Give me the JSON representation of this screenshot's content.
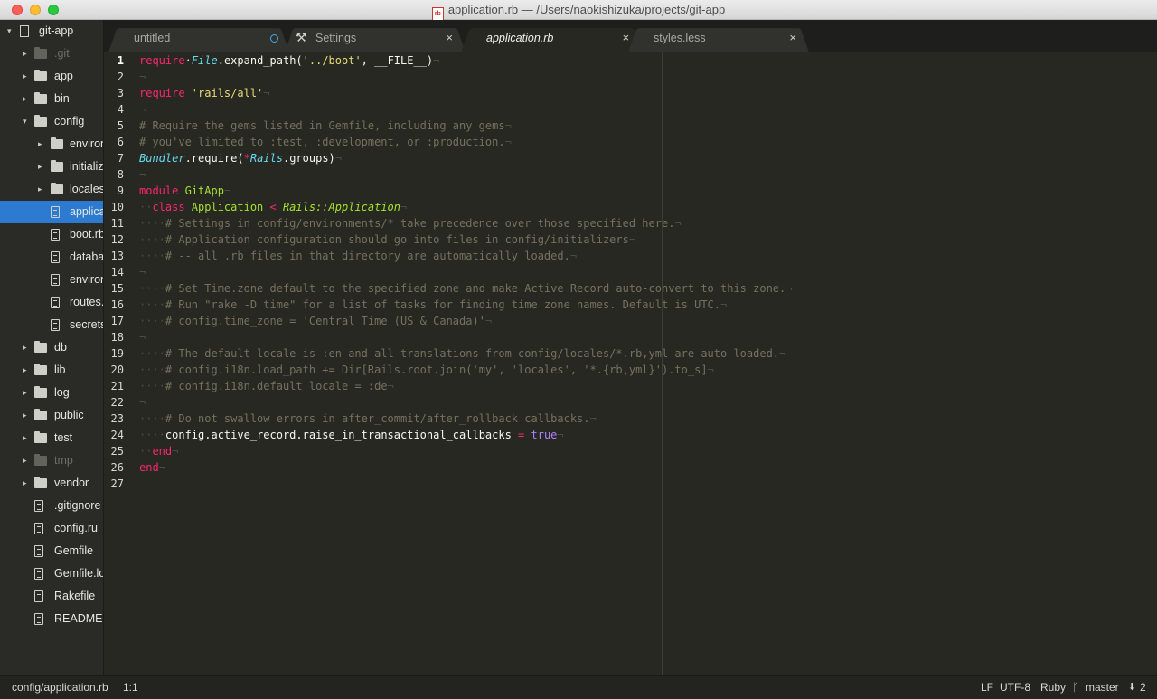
{
  "window": {
    "title": "application.rb — /Users/naokishizuka/projects/git-app",
    "file_badge": "rb"
  },
  "sidebar": {
    "items": [
      {
        "label": "git-app",
        "kind": "repo",
        "depth": 0,
        "arrow": "▾"
      },
      {
        "label": ".git",
        "kind": "folder",
        "depth": 1,
        "arrow": "▸",
        "dim": true
      },
      {
        "label": "app",
        "kind": "folder",
        "depth": 1,
        "arrow": "▸"
      },
      {
        "label": "bin",
        "kind": "folder",
        "depth": 1,
        "arrow": "▸"
      },
      {
        "label": "config",
        "kind": "folder",
        "depth": 1,
        "arrow": "▾"
      },
      {
        "label": "environments",
        "kind": "folder",
        "depth": 2,
        "arrow": "▸"
      },
      {
        "label": "initializers",
        "kind": "folder",
        "depth": 2,
        "arrow": "▸"
      },
      {
        "label": "locales",
        "kind": "folder",
        "depth": 2,
        "arrow": "▸"
      },
      {
        "label": "application.rb",
        "kind": "file",
        "depth": 2,
        "selected": true
      },
      {
        "label": "boot.rb",
        "kind": "file",
        "depth": 2
      },
      {
        "label": "database.yml",
        "kind": "file",
        "depth": 2
      },
      {
        "label": "environment.rb",
        "kind": "file",
        "depth": 2
      },
      {
        "label": "routes.rb",
        "kind": "file",
        "depth": 2
      },
      {
        "label": "secrets.yml",
        "kind": "file",
        "depth": 2
      },
      {
        "label": "db",
        "kind": "folder",
        "depth": 1,
        "arrow": "▸"
      },
      {
        "label": "lib",
        "kind": "folder",
        "depth": 1,
        "arrow": "▸"
      },
      {
        "label": "log",
        "kind": "folder",
        "depth": 1,
        "arrow": "▸"
      },
      {
        "label": "public",
        "kind": "folder",
        "depth": 1,
        "arrow": "▸"
      },
      {
        "label": "test",
        "kind": "folder",
        "depth": 1,
        "arrow": "▸"
      },
      {
        "label": "tmp",
        "kind": "folder",
        "depth": 1,
        "arrow": "▸",
        "dim": true
      },
      {
        "label": "vendor",
        "kind": "folder",
        "depth": 1,
        "arrow": "▸"
      },
      {
        "label": ".gitignore",
        "kind": "file",
        "depth": 1
      },
      {
        "label": "config.ru",
        "kind": "file",
        "depth": 1
      },
      {
        "label": "Gemfile",
        "kind": "file",
        "depth": 1
      },
      {
        "label": "Gemfile.lock",
        "kind": "file",
        "depth": 1
      },
      {
        "label": "Rakefile",
        "kind": "file",
        "depth": 1
      },
      {
        "label": "README.rdoc",
        "kind": "file",
        "depth": 1
      }
    ]
  },
  "tabs": [
    {
      "label": "untitled",
      "modified": true,
      "close": "",
      "icon": ""
    },
    {
      "label": "Settings",
      "close": "×",
      "icon": "⚒"
    },
    {
      "label": "application.rb",
      "close": "×",
      "active": true,
      "icon": ""
    },
    {
      "label": "styles.less",
      "close": "×",
      "icon": ""
    }
  ],
  "editor": {
    "current_line": 1,
    "lines": [
      [
        [
          "kw",
          "require"
        ],
        [
          "",
          "·"
        ],
        [
          "cls",
          "File"
        ],
        [
          "",
          ".expand_path("
        ],
        [
          "str",
          "'../boot'"
        ],
        [
          "",
          ", __FILE__)"
        ],
        [
          "inv",
          "¬"
        ]
      ],
      [
        [
          "inv",
          "¬"
        ]
      ],
      [
        [
          "kw",
          "require"
        ],
        [
          "",
          ""
        ],
        [
          "str",
          " 'rails/all'"
        ],
        [
          "inv",
          "¬"
        ]
      ],
      [
        [
          "inv",
          "¬"
        ]
      ],
      [
        [
          "cm",
          "# Require the gems listed in Gemfile, including any gems"
        ],
        [
          "inv",
          "¬"
        ]
      ],
      [
        [
          "cm",
          "# you've limited to :test, :development, or :production."
        ],
        [
          "inv",
          "¬"
        ]
      ],
      [
        [
          "cls",
          "Bundler"
        ],
        [
          "",
          ".require("
        ],
        [
          "op",
          "*"
        ],
        [
          "cls",
          "Rails"
        ],
        [
          "",
          ".groups)"
        ],
        [
          "inv",
          "¬"
        ]
      ],
      [
        [
          "inv",
          "¬"
        ]
      ],
      [
        [
          "kw",
          "module"
        ],
        [
          "",
          ""
        ],
        [
          "ent",
          " GitApp"
        ],
        [
          "inv",
          "¬"
        ]
      ],
      [
        [
          "inv",
          "··"
        ],
        [
          "kw",
          "class"
        ],
        [
          "ent",
          " Application "
        ],
        [
          "op",
          "<"
        ],
        [
          "inh",
          " Rails::Application"
        ],
        [
          "inv",
          "¬"
        ]
      ],
      [
        [
          "inv",
          "····"
        ],
        [
          "cm",
          "# Settings in config/environments/* take precedence over those specified here."
        ],
        [
          "inv",
          "¬"
        ]
      ],
      [
        [
          "inv",
          "····"
        ],
        [
          "cm",
          "# Application configuration should go into files in config/initializers"
        ],
        [
          "inv",
          "¬"
        ]
      ],
      [
        [
          "inv",
          "····"
        ],
        [
          "cm",
          "# -- all .rb files in that directory are automatically loaded."
        ],
        [
          "inv",
          "¬"
        ]
      ],
      [
        [
          "inv",
          "¬"
        ]
      ],
      [
        [
          "inv",
          "····"
        ],
        [
          "cm",
          "# Set Time.zone default to the specified zone and make Active Record auto-convert to this zone."
        ],
        [
          "inv",
          "¬"
        ]
      ],
      [
        [
          "inv",
          "····"
        ],
        [
          "cm",
          "# Run \"rake -D time\" for a list of tasks for finding time zone names. Default is UTC."
        ],
        [
          "inv",
          "¬"
        ]
      ],
      [
        [
          "inv",
          "····"
        ],
        [
          "cm",
          "# config.time_zone = 'Central Time (US & Canada)'"
        ],
        [
          "inv",
          "¬"
        ]
      ],
      [
        [
          "inv",
          "¬"
        ]
      ],
      [
        [
          "inv",
          "····"
        ],
        [
          "cm",
          "# The default locale is :en and all translations from config/locales/*.rb,yml are auto loaded."
        ],
        [
          "inv",
          "¬"
        ]
      ],
      [
        [
          "inv",
          "····"
        ],
        [
          "cm",
          "# config.i18n.load_path += Dir[Rails.root.join('my', 'locales', '*.{rb,yml}').to_s]"
        ],
        [
          "inv",
          "¬"
        ]
      ],
      [
        [
          "inv",
          "····"
        ],
        [
          "cm",
          "# config.i18n.default_locale = :de"
        ],
        [
          "inv",
          "¬"
        ]
      ],
      [
        [
          "inv",
          "¬"
        ]
      ],
      [
        [
          "inv",
          "····"
        ],
        [
          "cm",
          "# Do not swallow errors in after_commit/after_rollback callbacks."
        ],
        [
          "inv",
          "¬"
        ]
      ],
      [
        [
          "inv",
          "····"
        ],
        [
          "",
          "config.active_record.raise_in_transactional_callbacks "
        ],
        [
          "op",
          "="
        ],
        [
          "con",
          " true"
        ],
        [
          "inv",
          "¬"
        ]
      ],
      [
        [
          "inv",
          "··"
        ],
        [
          "kw",
          "end"
        ],
        [
          "inv",
          "¬"
        ]
      ],
      [
        [
          "kw",
          "end"
        ],
        [
          "inv",
          "¬"
        ]
      ],
      []
    ]
  },
  "status": {
    "path": "config/application.rb",
    "cursor": "1:1",
    "line_ending": "LF",
    "encoding": "UTF-8",
    "syntax": "Ruby",
    "branch": "master",
    "branch_icon": "git-branch-icon",
    "ahead": "2",
    "ahead_icon": "arrow-down-icon"
  }
}
